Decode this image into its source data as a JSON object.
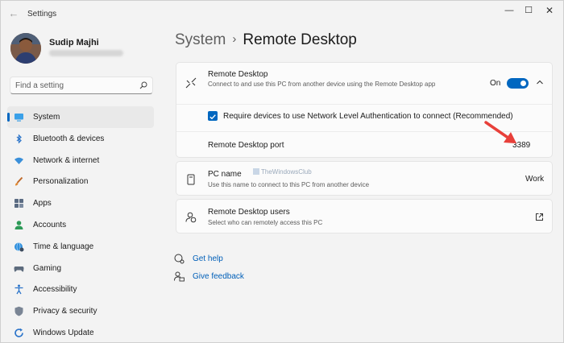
{
  "window": {
    "title": "Settings",
    "minimize": "—",
    "maximize": "☐",
    "close": "✕",
    "back": "←"
  },
  "account": {
    "name": "Sudip Majhi"
  },
  "search": {
    "placeholder": "Find a setting"
  },
  "nav": {
    "items": [
      {
        "label": "System",
        "icon": "system-icon",
        "active": true
      },
      {
        "label": "Bluetooth & devices",
        "icon": "bluetooth-icon"
      },
      {
        "label": "Network & internet",
        "icon": "wifi-icon"
      },
      {
        "label": "Personalization",
        "icon": "brush-icon"
      },
      {
        "label": "Apps",
        "icon": "apps-icon"
      },
      {
        "label": "Accounts",
        "icon": "person-icon"
      },
      {
        "label": "Time & language",
        "icon": "globe-clock-icon"
      },
      {
        "label": "Gaming",
        "icon": "gamepad-icon"
      },
      {
        "label": "Accessibility",
        "icon": "accessibility-icon"
      },
      {
        "label": "Privacy & security",
        "icon": "shield-icon"
      },
      {
        "label": "Windows Update",
        "icon": "update-icon"
      }
    ]
  },
  "breadcrumb": {
    "parent": "System",
    "separator": "›",
    "current": "Remote Desktop"
  },
  "remote_desktop": {
    "title": "Remote Desktop",
    "description": "Connect to and use this PC from another device using the Remote Desktop app",
    "toggle_label": "On",
    "toggle_on": true,
    "nla_label": "Require devices to use Network Level Authentication to connect (Recommended)",
    "nla_checked": true,
    "port_label": "Remote Desktop port",
    "port_value": "3389"
  },
  "pc_name": {
    "title": "PC name",
    "description": "Use this name to connect to this PC from another device",
    "value": "Work",
    "watermark": "TheWindowsClub"
  },
  "users": {
    "title": "Remote Desktop users",
    "description": "Select who can remotely access this PC"
  },
  "links": {
    "help": "Get help",
    "feedback": "Give feedback"
  },
  "colors": {
    "accent": "#0067c0",
    "link": "#005fb8",
    "annotation_arrow": "#e8403a",
    "background": "#f3f3f3",
    "card": "#fbfbfb"
  }
}
